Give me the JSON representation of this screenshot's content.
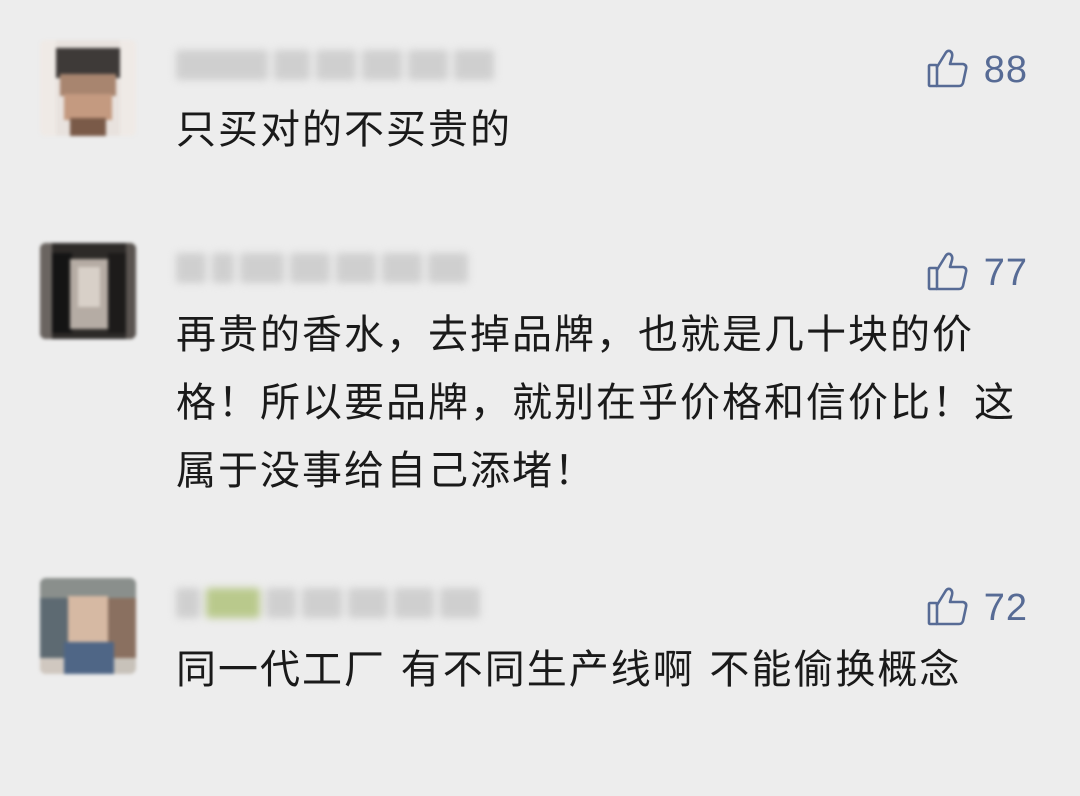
{
  "comments": [
    {
      "text": "只买对的不买贵的",
      "likes": "88",
      "like_icon": "thumbs-up-icon"
    },
    {
      "text": "再贵的香水，去掉品牌，也就是几十块的价格！所以要品牌，就别在乎价格和信价比！这属于没事给自己添堵！",
      "likes": "77",
      "like_icon": "thumbs-up-icon"
    },
    {
      "text": "同一代工厂 有不同生产线啊 不能偷换概念",
      "likes": "72",
      "like_icon": "thumbs-up-icon"
    }
  ],
  "colors": {
    "background": "#ededed",
    "like_accent": "#576b95",
    "text": "#1a1a1a"
  }
}
